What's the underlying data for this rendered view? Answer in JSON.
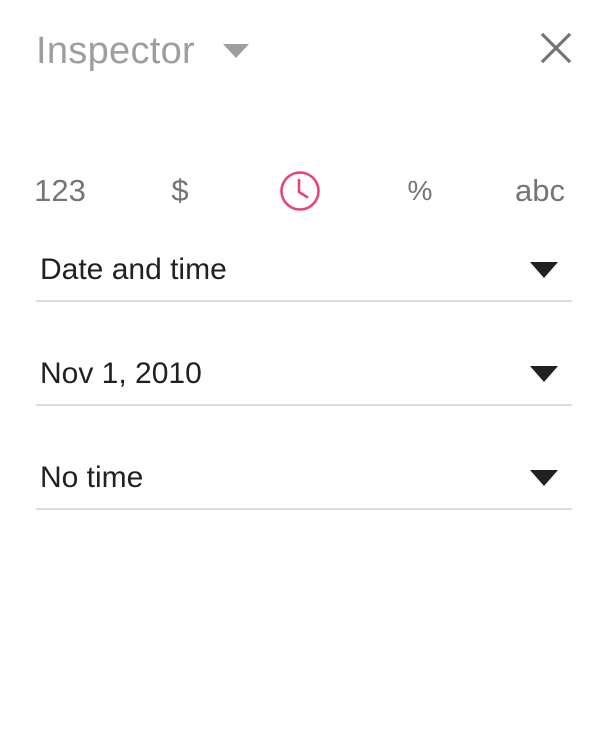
{
  "header": {
    "title": "Inspector",
    "title_menu_icon": "caret-down-icon",
    "close_icon": "close-icon"
  },
  "format_tabs": [
    {
      "label": "123",
      "kind": "number",
      "selected": false
    },
    {
      "label": "$",
      "kind": "currency",
      "selected": false
    },
    {
      "label": "",
      "kind": "date-time",
      "icon": "clock-icon",
      "selected": true
    },
    {
      "label": "%",
      "kind": "percent",
      "selected": false
    },
    {
      "label": "abc",
      "kind": "text",
      "selected": false
    }
  ],
  "fields": {
    "format_type": "Date and time",
    "date_format": "Nov 1, 2010",
    "time_format": "No time"
  },
  "colors": {
    "accent": "#e8437c",
    "title_gray": "#9e9e9e",
    "tab_gray": "#757575",
    "text": "#212121",
    "divider": "#dcdcdc"
  }
}
